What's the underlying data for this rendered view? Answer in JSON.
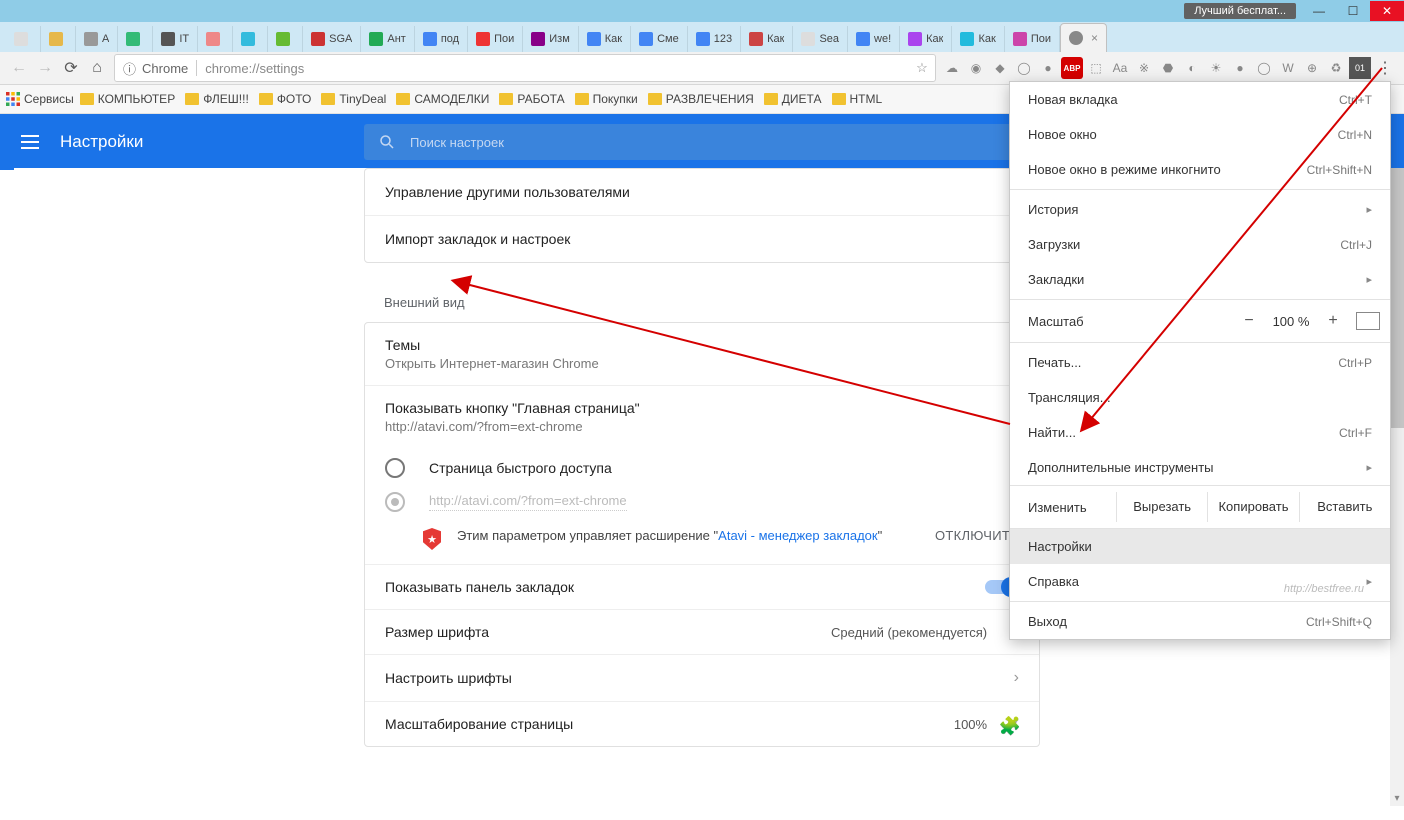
{
  "window": {
    "badge": "Лучший бесплат...",
    "min": "—",
    "max": "☐",
    "close": "✕"
  },
  "tabs": [
    {
      "label": ""
    },
    {
      "label": ""
    },
    {
      "label": "A"
    },
    {
      "label": ""
    },
    {
      "label": "IT"
    },
    {
      "label": ""
    },
    {
      "label": ""
    },
    {
      "label": ""
    },
    {
      "label": "SGA"
    },
    {
      "label": "Ант"
    },
    {
      "label": "под"
    },
    {
      "label": "Пои"
    },
    {
      "label": "Изм"
    },
    {
      "label": "Как"
    },
    {
      "label": "Сме"
    },
    {
      "label": "123"
    },
    {
      "label": "Как"
    },
    {
      "label": "Sea"
    },
    {
      "label": "we!"
    },
    {
      "label": "Как"
    },
    {
      "label": "Как"
    },
    {
      "label": "Пои"
    }
  ],
  "active_tab": {
    "label": ""
  },
  "omnibox": {
    "origin_icon": "ⓘ",
    "origin": "Chrome",
    "url": "chrome://settings"
  },
  "bookmarks": {
    "services": "Сервисы",
    "items": [
      "КОМПЬЮТЕР",
      "ФЛЕШ!!!",
      "ФОТО",
      "TinyDeal",
      "САМОДЕЛКИ",
      "РАБОТА",
      "Покупки",
      "РАЗВЛЕЧЕНИЯ",
      "ДИЕТА",
      "HTML"
    ]
  },
  "settings": {
    "title": "Настройки",
    "search_placeholder": "Поиск настроек",
    "row_manage_users": "Управление другими пользователями",
    "row_import": "Импорт закладок и настроек",
    "section_appearance": "Внешний вид",
    "themes_title": "Темы",
    "themes_sub": "Открыть Интернет-магазин Chrome",
    "home_title": "Показывать кнопку \"Главная страница\"",
    "home_sub": "http://atavi.com/?from=ext-chrome",
    "radio1": "Страница быстрого доступа",
    "radio2": "http://atavi.com/?from=ext-chrome",
    "notice_pre": "Этим параметром управляет расширение \"",
    "notice_link": "Atavi - менеджер закладок",
    "notice_post": "\"",
    "disable": "ОТКЛЮЧИТЬ",
    "bookmarks_bar": "Показывать панель закладок",
    "font_size": "Размер шрифта",
    "font_size_val": "Средний (рекомендуется)",
    "customize_fonts": "Настроить шрифты",
    "page_zoom": "Масштабирование страницы",
    "page_zoom_val": "100%"
  },
  "menu": {
    "new_tab": "Новая вкладка",
    "new_tab_sc": "Ctrl+T",
    "new_window": "Новое окно",
    "new_window_sc": "Ctrl+N",
    "incognito": "Новое окно в режиме инкогнито",
    "incognito_sc": "Ctrl+Shift+N",
    "history": "История",
    "downloads": "Загрузки",
    "downloads_sc": "Ctrl+J",
    "bookmarks": "Закладки",
    "zoom": "Масштаб",
    "zoom_val": "100 %",
    "print": "Печать...",
    "print_sc": "Ctrl+P",
    "cast": "Трансляция...",
    "find": "Найти...",
    "find_sc": "Ctrl+F",
    "more_tools": "Дополнительные инструменты",
    "edit": "Изменить",
    "cut": "Вырезать",
    "copy": "Копировать",
    "paste": "Вставить",
    "settings": "Настройки",
    "help": "Справка",
    "exit": "Выход",
    "exit_sc": "Ctrl+Shift+Q"
  },
  "watermark": "http://bestfree.ru",
  "ext_icons": [
    "☁",
    "◉",
    "◆",
    "◯",
    "●",
    "ABP",
    "⬚",
    "Aa",
    "※",
    "⬣",
    "◐",
    "☀",
    "●",
    "◯",
    "W",
    "⊕",
    "♻",
    "01"
  ],
  "tab_fav_colors": [
    "#ddd",
    "#e6b84a",
    "#999",
    "#3b7",
    "#555",
    "#e88",
    "#3bd",
    "#6b3",
    "#c33",
    "#2a5",
    "#4285f4",
    "#e33",
    "#808",
    "#4285f4",
    "#4285f4",
    "#4285f4",
    "#c44",
    "#ddd",
    "#4285f4",
    "#a4e",
    "#2bd",
    "#c4a"
  ]
}
